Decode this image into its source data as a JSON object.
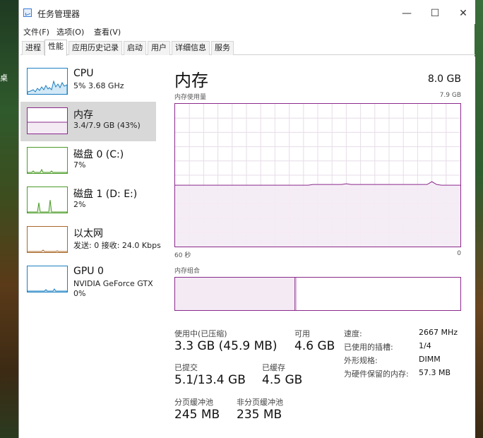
{
  "desktop": {
    "icon_label": "桌"
  },
  "window": {
    "title": "任务管理器",
    "minimize": "—",
    "maximize": "☐",
    "close": "✕"
  },
  "menu": [
    "文件(F)",
    "选项(O)",
    "查看(V)"
  ],
  "tabs": [
    "进程",
    "性能",
    "应用历史记录",
    "启动",
    "用户",
    "详细信息",
    "服务"
  ],
  "active_tab": "性能",
  "sidebar": {
    "items": [
      {
        "name": "CPU",
        "line1": "5%  3.68 GHz",
        "line2": "",
        "color": "#1a7fc1"
      },
      {
        "name": "内存",
        "line1": "3.4/7.9 GB (43%)",
        "line2": "",
        "color": "#8b2a8b"
      },
      {
        "name": "磁盘 0 (C:)",
        "line1": "7%",
        "line2": "",
        "color": "#4c9a2a"
      },
      {
        "name": "磁盘 1 (D: E:)",
        "line1": "2%",
        "line2": "",
        "color": "#4c9a2a"
      },
      {
        "name": "以太网",
        "line1": "发送: 0  接收: 24.0 Kbps",
        "line2": "",
        "color": "#a8682a"
      },
      {
        "name": "GPU 0",
        "line1": "NVIDIA GeForce GTX",
        "line2": "0%",
        "color": "#1a7fc1"
      }
    ]
  },
  "memory": {
    "title": "内存",
    "total": "8.0 GB",
    "usage_label": "内存使用量",
    "usage_max": "7.9 GB",
    "time_left": "60 秒",
    "time_right": "0",
    "usage_fraction": 0.43,
    "composition_label": "内存组合",
    "stats": {
      "in_use_label": "使用中(已压缩)",
      "in_use_value": "3.3 GB (45.9 MB)",
      "available_label": "可用",
      "available_value": "4.6 GB",
      "committed_label": "已提交",
      "committed_value": "5.1/13.4 GB",
      "cached_label": "已缓存",
      "cached_value": "4.5 GB",
      "paged_label": "分页缓冲池",
      "paged_value": "245 MB",
      "nonpaged_label": "非分页缓冲池",
      "nonpaged_value": "235 MB"
    },
    "specs": {
      "speed_label": "速度:",
      "speed_value": "2667 MHz",
      "slots_label": "已使用的插槽:",
      "slots_value": "1/4",
      "form_label": "外形规格:",
      "form_value": "DIMM",
      "reserved_label": "为硬件保留的内存:",
      "reserved_value": "57.3 MB"
    }
  },
  "colors": {
    "memory_accent": "#8b2a8b",
    "graph_grid": "#e7dce8"
  }
}
